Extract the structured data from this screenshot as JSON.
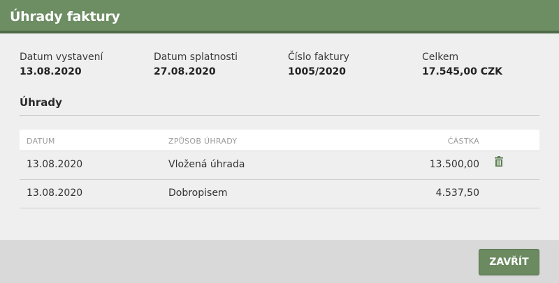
{
  "dialog": {
    "title": "Úhrady faktury"
  },
  "invoice": {
    "issue_date": {
      "label": "Datum vystavení",
      "value": "13.08.2020"
    },
    "due_date": {
      "label": "Datum splatnosti",
      "value": "27.08.2020"
    },
    "number": {
      "label": "Číslo faktury",
      "value": "1005/2020"
    },
    "total": {
      "label": "Celkem",
      "value": "17.545,00 CZK"
    }
  },
  "payments": {
    "section_title": "Úhrady",
    "headers": {
      "date": "DATUM",
      "method": "ZPŮSOB ÚHRADY",
      "amount": "ČÁSTKA"
    },
    "rows": [
      {
        "date": "13.08.2020",
        "method": "Vložená úhrada",
        "amount": "13.500,00",
        "deletable": true
      },
      {
        "date": "13.08.2020",
        "method": "Dobropisem",
        "amount": "4.537,50",
        "deletable": false
      }
    ]
  },
  "footer": {
    "close_label": "ZAVŘÍT"
  },
  "icons": {
    "delete": "trash-icon"
  },
  "colors": {
    "brand": "#6d8d63",
    "brand_dark": "#4f6a48",
    "button": "#6b8a60"
  }
}
